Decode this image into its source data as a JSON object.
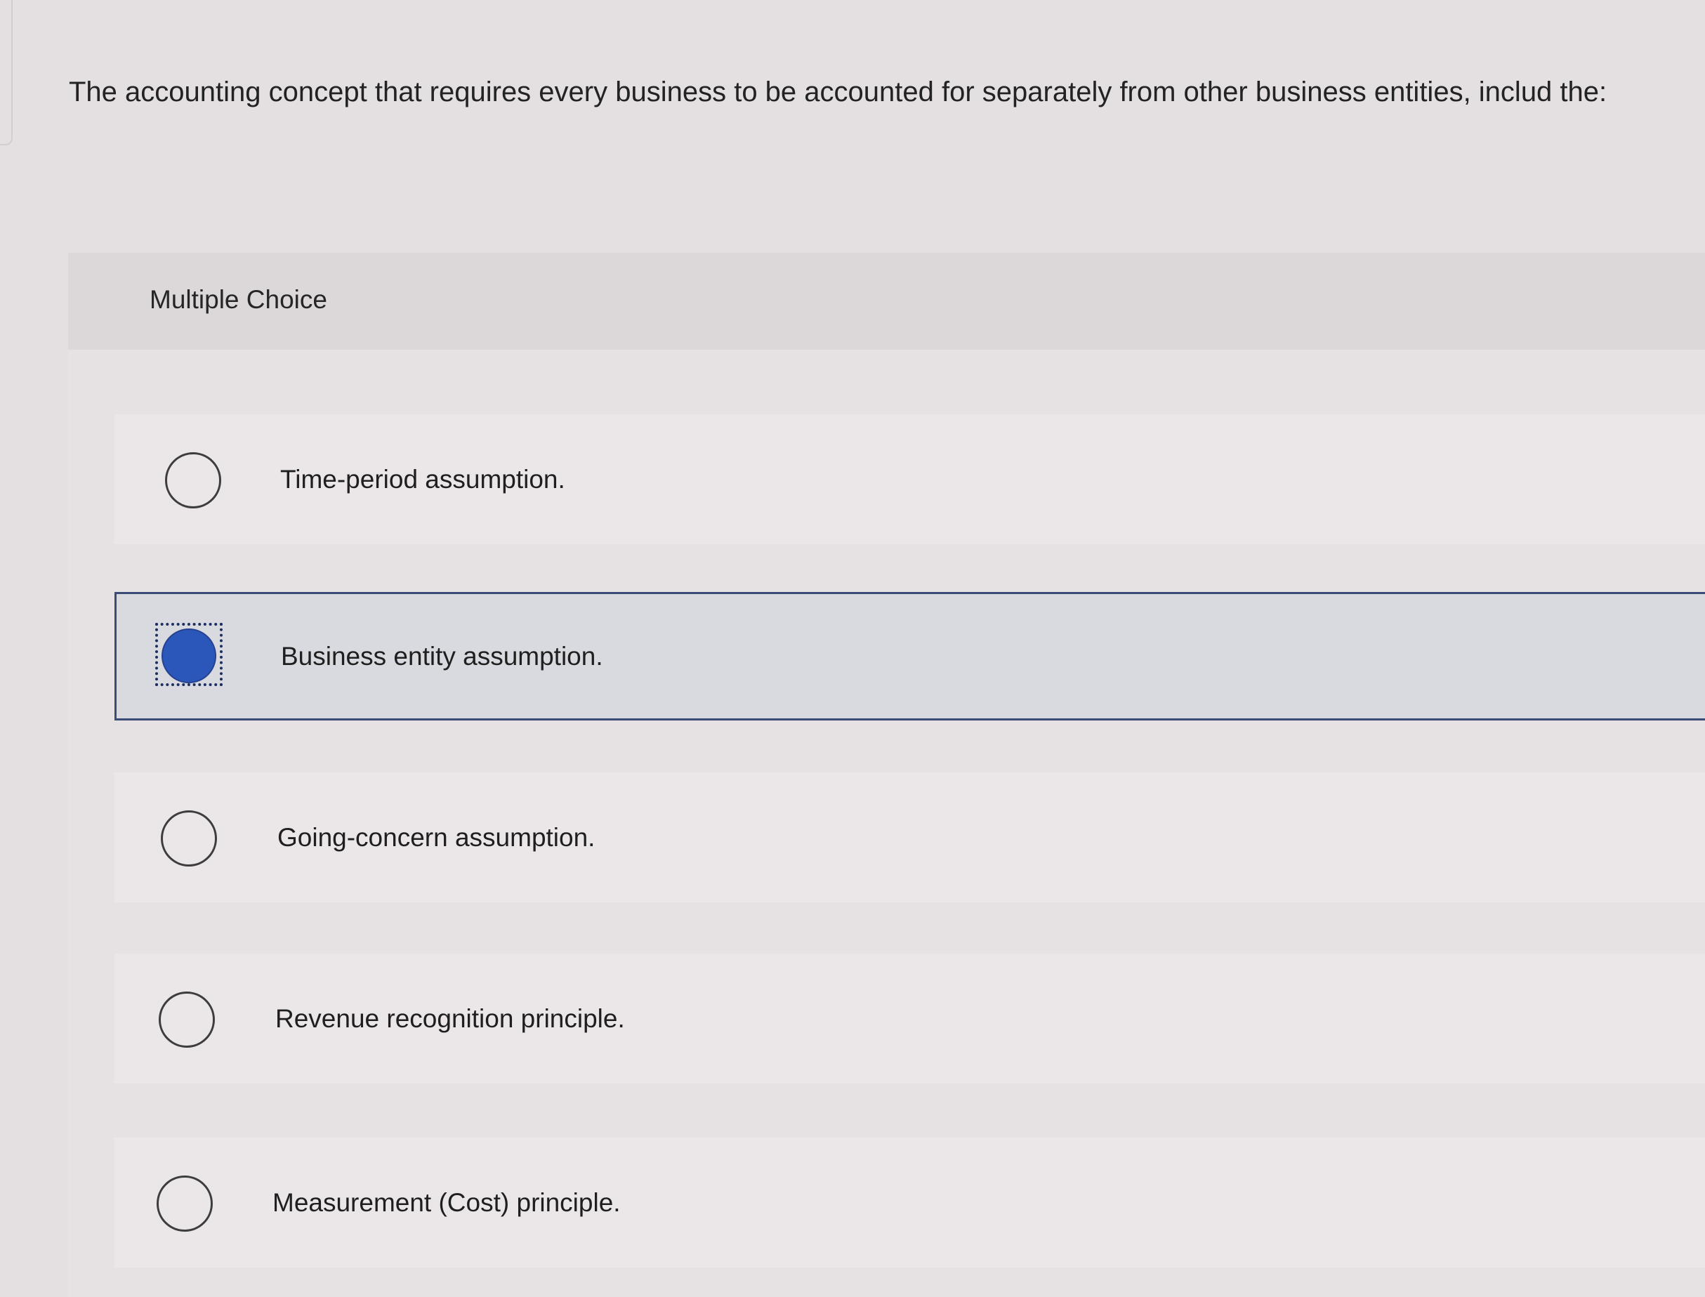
{
  "question": {
    "text": "The accounting concept that requires every business to be accounted for separately from other business entities, includ the:"
  },
  "panel": {
    "label": "Multiple Choice"
  },
  "options": [
    {
      "label": "Time-period assumption.",
      "selected": false
    },
    {
      "label": "Business entity assumption.",
      "selected": true
    },
    {
      "label": "Going-concern assumption.",
      "selected": false
    },
    {
      "label": "Revenue recognition principle.",
      "selected": false
    },
    {
      "label": "Measurement (Cost) principle.",
      "selected": false
    }
  ],
  "colors": {
    "selected_fill": "#2b57ba",
    "selected_border": "#3c4c79",
    "background": "#e4dfe1"
  }
}
